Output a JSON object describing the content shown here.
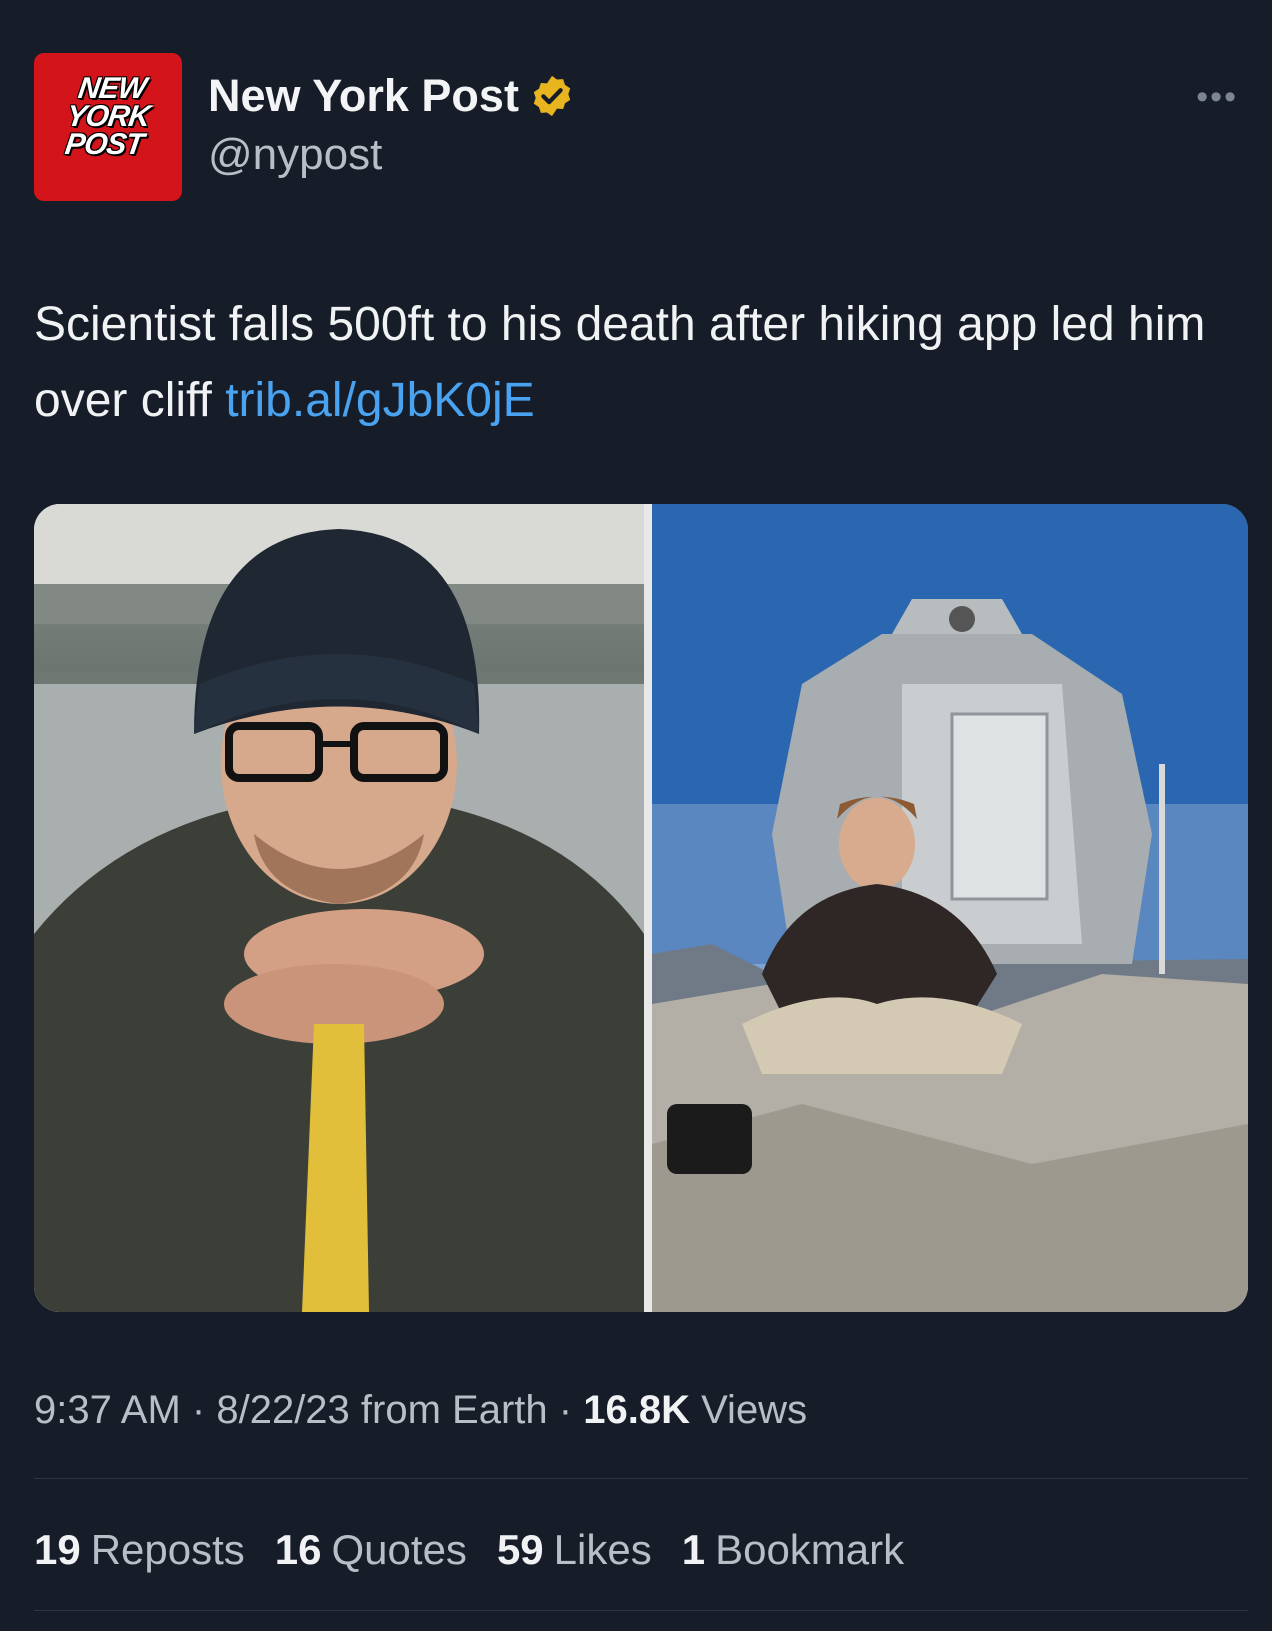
{
  "author": {
    "avatar_logo_text": "NEW YORK POST",
    "name": "New York Post",
    "handle": "@nypost",
    "verified_icon": "gold-verified-badge-icon"
  },
  "more_icon": "more-horizontal-icon",
  "tweet": {
    "text": "Scientist falls 500ft to his death after hiking app led him over cliff",
    "link": "trib.al/gJbK0jE"
  },
  "media": [
    {
      "name": "photo-man-in-beanie",
      "description_icon": "photo"
    },
    {
      "name": "photo-man-by-hut",
      "description_icon": "photo"
    }
  ],
  "meta": {
    "time": "9:37 AM",
    "separator": "·",
    "date_source": "8/22/23 from Earth",
    "views_count": "16.8K",
    "views_label": "Views"
  },
  "stats": {
    "reposts_count": "19",
    "reposts_label": "Reposts",
    "quotes_count": "16",
    "quotes_label": "Quotes",
    "likes_count": "59",
    "likes_label": "Likes",
    "bookmarks_count": "1",
    "bookmarks_label": "Bookmark"
  },
  "colors": {
    "background": "#161d29",
    "link": "#4aa3f0",
    "avatar_red": "#d3141b",
    "verified_gold": "#e8b521"
  }
}
